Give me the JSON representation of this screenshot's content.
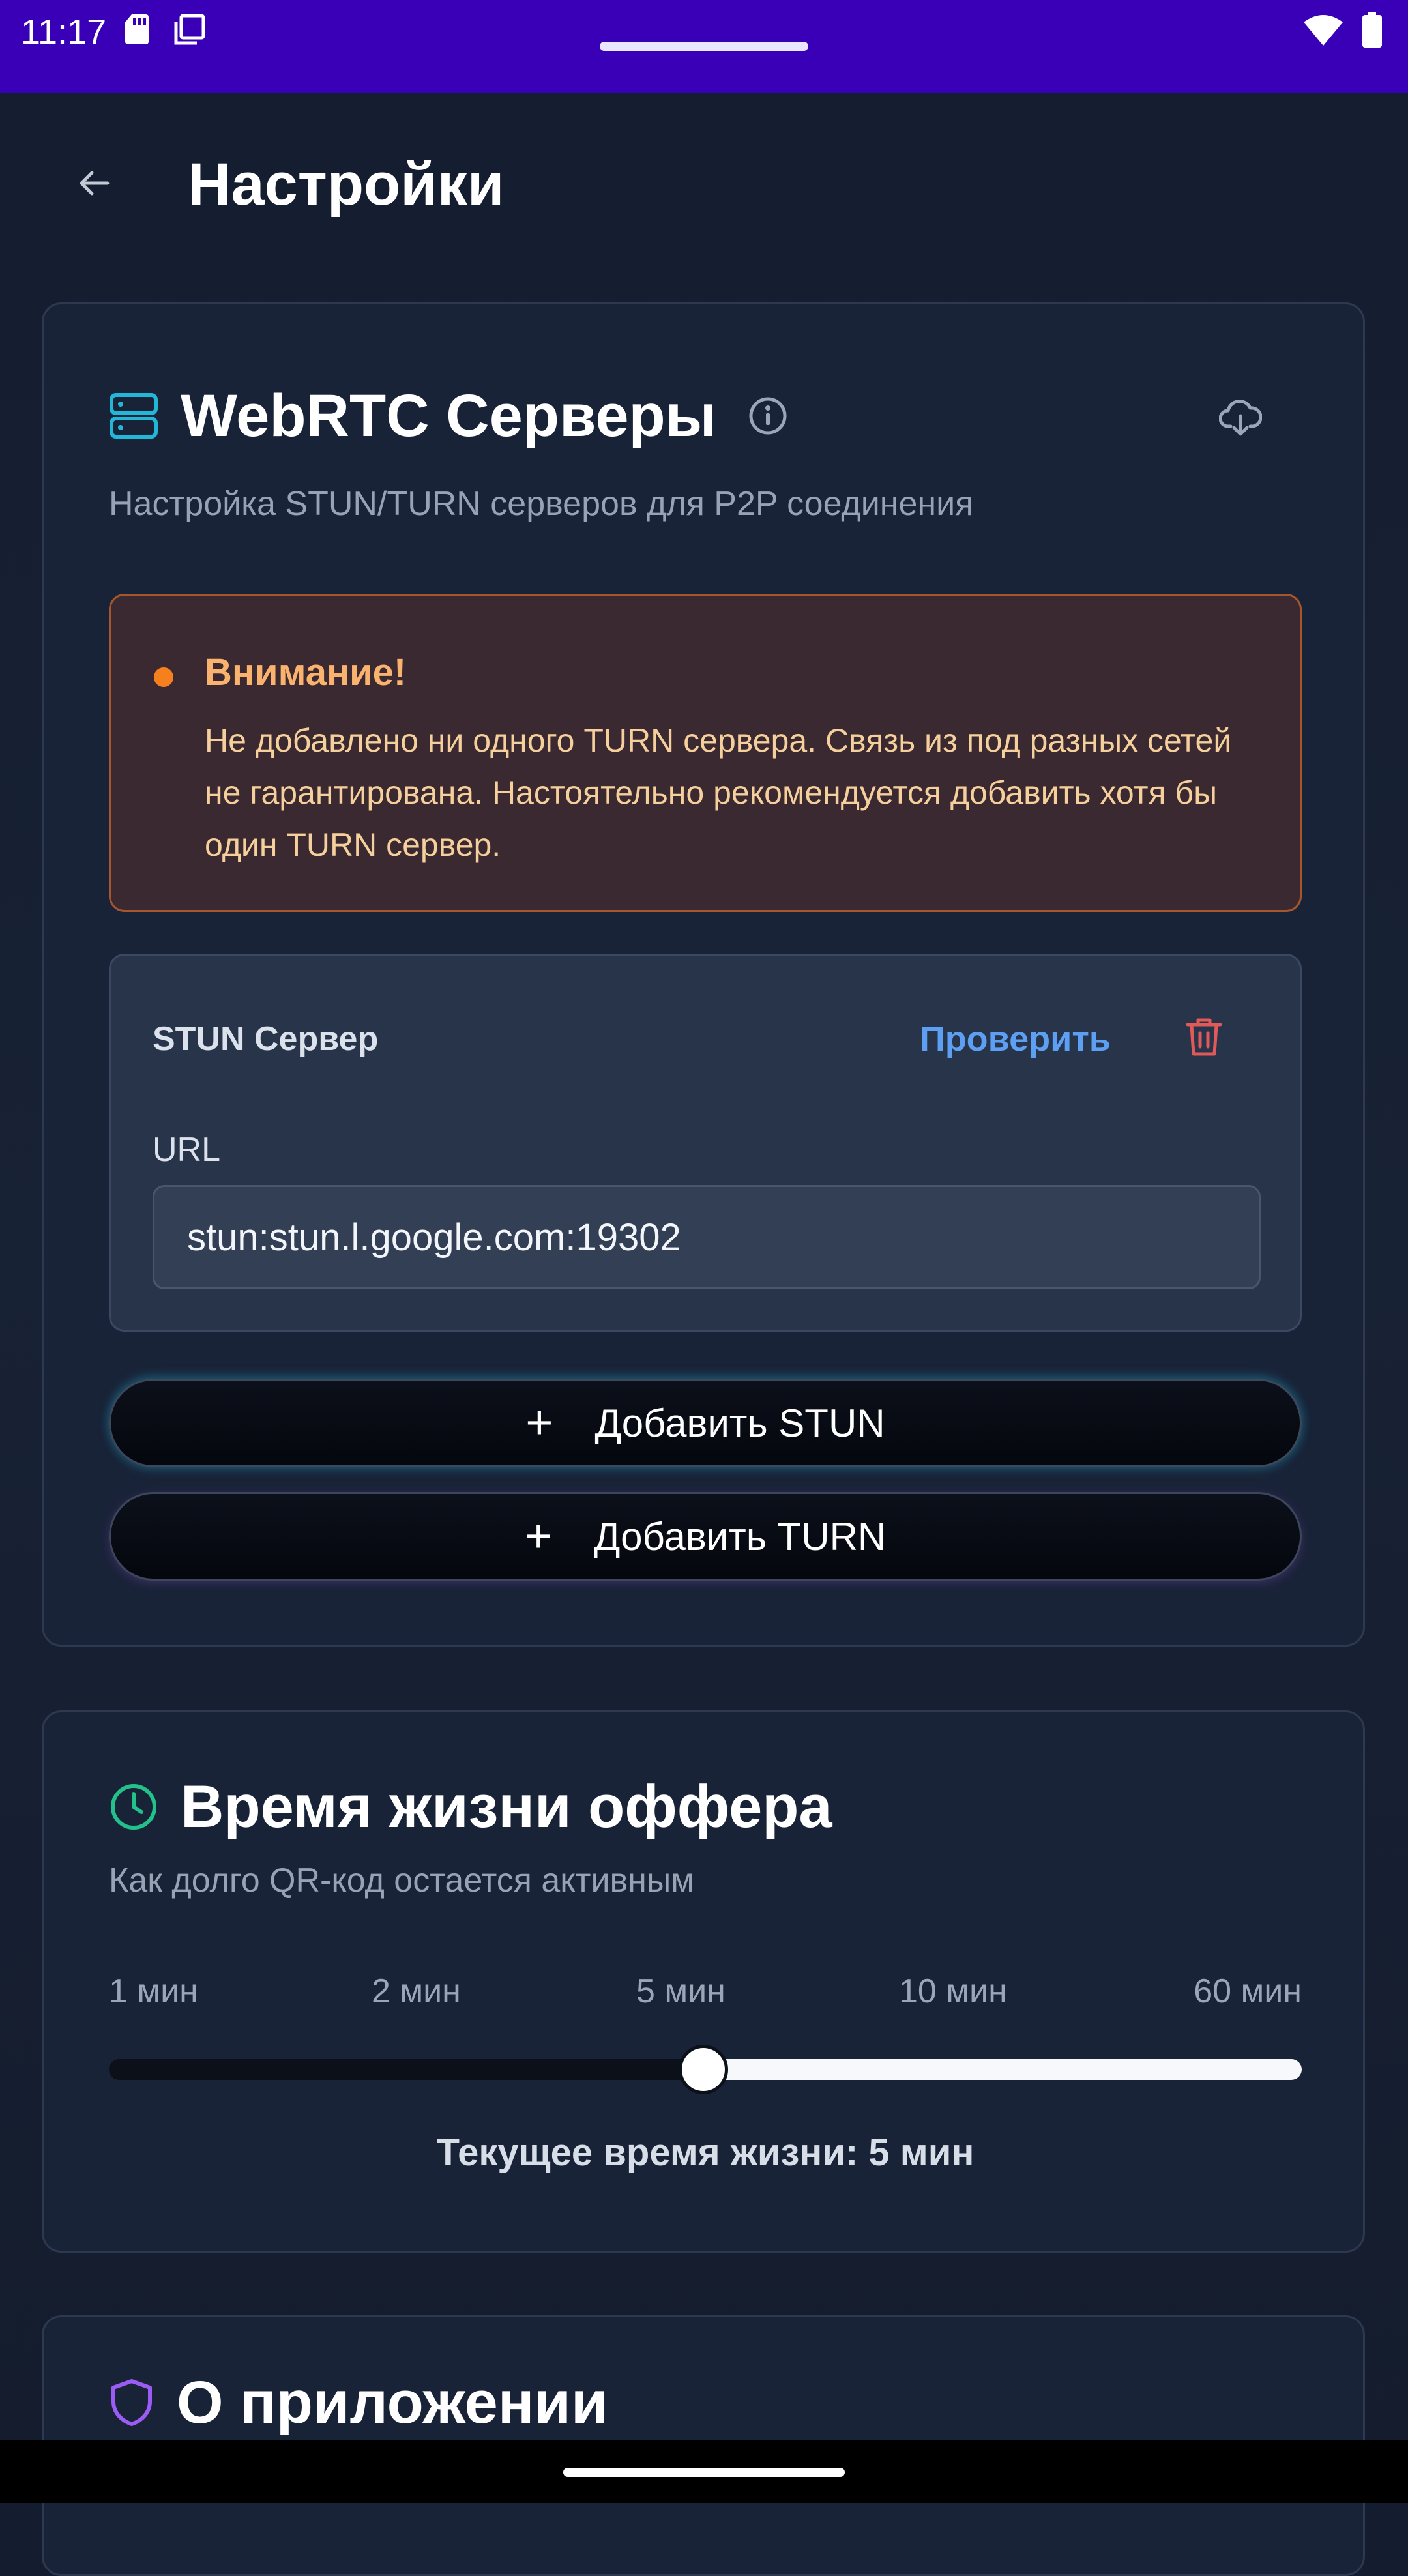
{
  "status_bar": {
    "time": "11:17",
    "left_icons": [
      "sd-card-icon",
      "screenshot-icon"
    ],
    "right_icons": [
      "wifi-icon",
      "battery-icon"
    ]
  },
  "header": {
    "title": "Настройки",
    "back_icon": "arrow-back-icon"
  },
  "webrtc": {
    "title": "WebRTC Серверы",
    "subtitle": "Настройка STUN/TURN серверов для P2P соединения",
    "icons": [
      "server-icon",
      "info-icon",
      "cloud-download-icon"
    ],
    "warning": {
      "title": "Внимание!",
      "text": "Не добавлено ни одного TURN сервера. Связь из под разных сетей не гарантирована. Настоятельно рекомендуется добавить хотя бы один TURN сервер."
    },
    "server": {
      "type": "STUN Сервер",
      "check_label": "Проверить",
      "url_label": "URL",
      "url_value": "stun:stun.l.google.com:19302"
    },
    "add_stun_label": "Добавить STUN",
    "add_turn_label": "Добавить TURN"
  },
  "offer_lifetime": {
    "title": "Время жизни оффера",
    "subtitle": "Как долго QR-код остается активным",
    "ticks": [
      "1 мин",
      "2 мин",
      "5 мин",
      "10 мин",
      "60 мин"
    ],
    "selected_index": 2,
    "current_label": "Текущее время жизни: 5 мин"
  },
  "about": {
    "title": "О приложении"
  },
  "colors": {
    "status_bar": "#3a00b8",
    "background": "#172033",
    "card": "#192338",
    "server_icon": "#22b6d8",
    "clock_icon": "#22c08a",
    "shield_icon": "#9b5cf6",
    "warning_border": "#a6562c",
    "warning_title": "#fab36f",
    "accent_link": "#5d9ff2",
    "delete": "#e05a5a"
  }
}
